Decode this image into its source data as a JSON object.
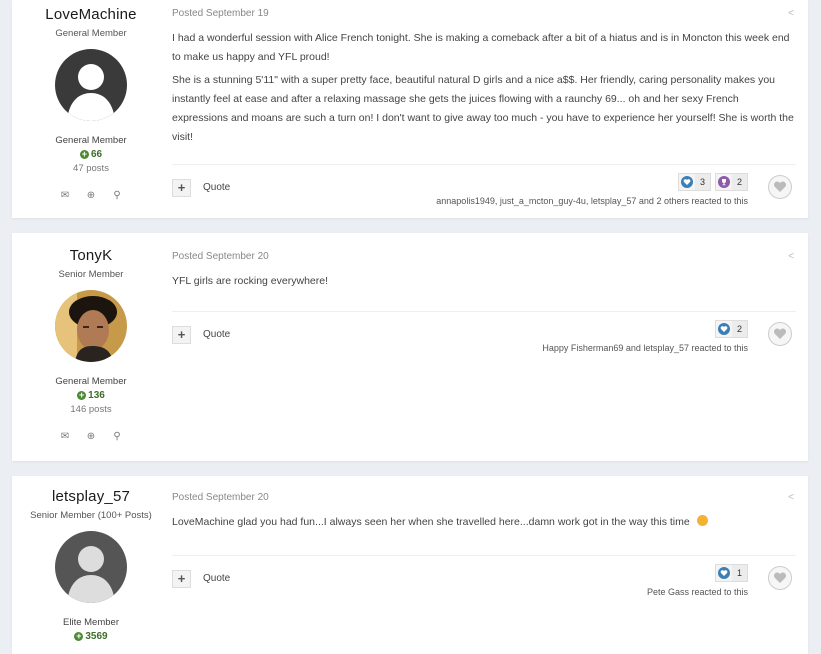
{
  "posts": [
    {
      "author_name": "LoveMachine",
      "author_title": "General Member",
      "group": "General Member",
      "reputation": "66",
      "post_count": "47 posts",
      "date": "Posted September 19",
      "paragraphs": [
        "I had a wonderful session with Alice French tonight. She is making a comeback after a bit of a hiatus and is in Moncton this week end to make us happy and YFL proud!",
        "She is a stunning 5'11\" with a super pretty face, beautiful natural D girls and a nice a$$. Her friendly, caring personality makes you instantly feel at ease and after a relaxing massage she gets the juices flowing with a raunchy 69... oh and her sexy French expressions and moans are such a turn on! I don't want to give away too much - you have to experience her yourself! She is worth the visit!"
      ],
      "quote_label": "Quote",
      "reactions": [
        {
          "icon": "heart-icon",
          "count": "3"
        },
        {
          "icon": "trophy-icon",
          "count": "2"
        }
      ],
      "reacted_text": "annapolis1949, just_a_mcton_guy-4u, letsplay_57 and 2 others reacted to this"
    },
    {
      "author_name": "TonyK",
      "author_title": "Senior Member",
      "group": "General Member",
      "reputation": "136",
      "post_count": "146 posts",
      "date": "Posted September 20",
      "paragraphs": [
        "YFL girls are rocking everywhere!"
      ],
      "quote_label": "Quote",
      "reactions": [
        {
          "icon": "heart-icon",
          "count": "2"
        }
      ],
      "reacted_text": "Happy Fisherman69 and letsplay_57 reacted to this"
    },
    {
      "author_name": "letsplay_57",
      "author_title": "Senior Member (100+ Posts)",
      "group": "Elite Member",
      "reputation": "3569",
      "post_count": "",
      "date": "Posted September 20",
      "paragraphs": [
        "LoveMachine glad you had fun...I always seen  her  when  she travelled here...damn work got in the way this time  "
      ],
      "quote_label": "Quote",
      "reactions": [
        {
          "icon": "heart-icon",
          "count": "1"
        }
      ],
      "reacted_text": "Pete Gass reacted to this"
    }
  ],
  "colors": {
    "background": "#ebeef2",
    "reputation": "#3f6e2a",
    "heart": "#3d7fb5",
    "trophy": "#8e5aa8"
  }
}
